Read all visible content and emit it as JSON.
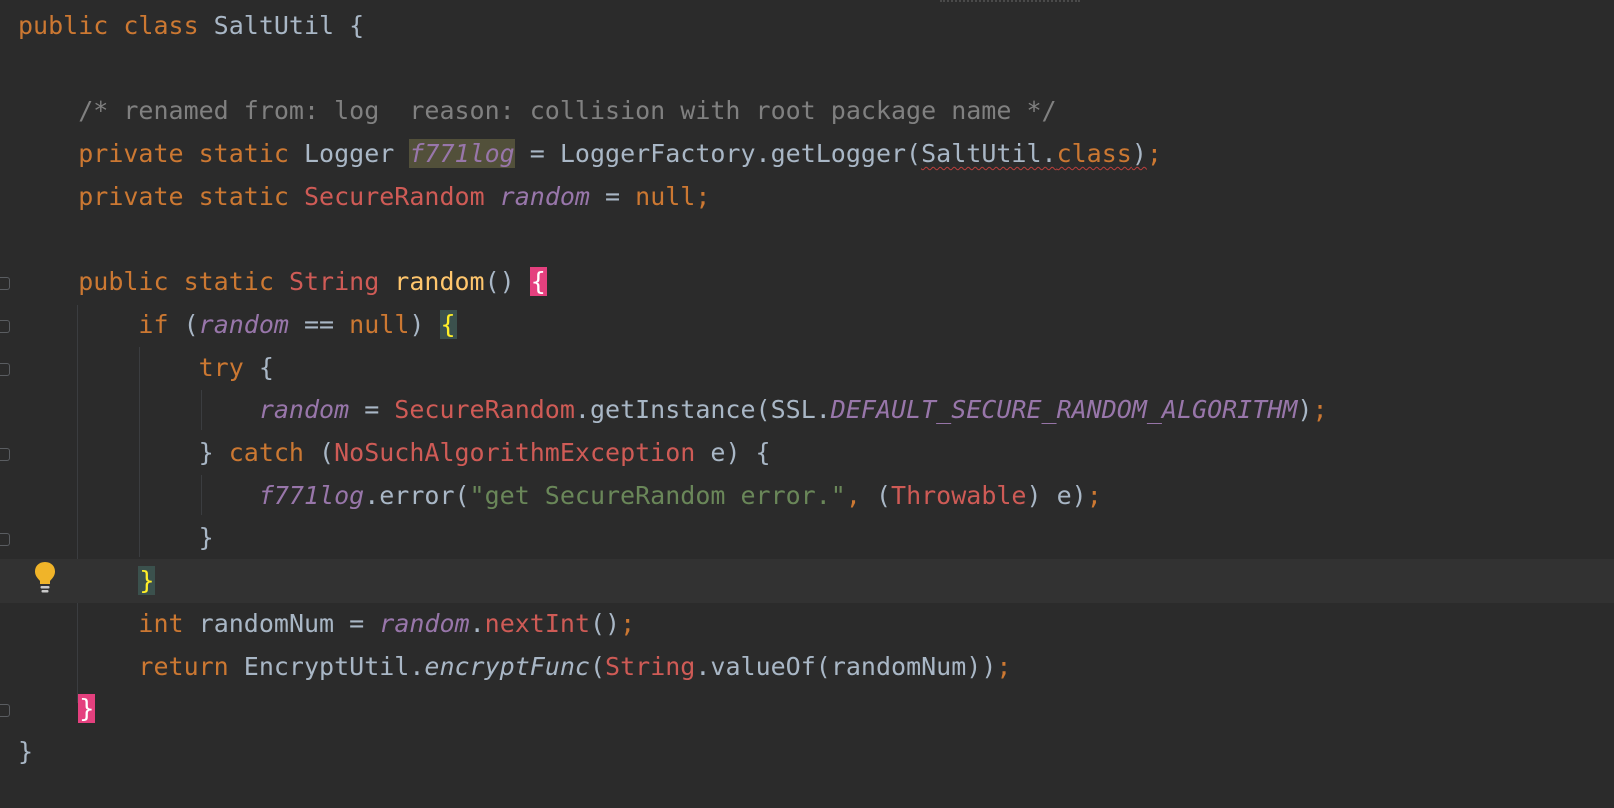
{
  "editor": {
    "language": "Java",
    "highlighted_usage": "f771log",
    "lines": [
      {
        "tokens": [
          [
            "kw",
            "public "
          ],
          [
            "kw",
            "class "
          ],
          [
            "cls",
            "SaltUtil "
          ],
          [
            "pl",
            "{"
          ]
        ]
      },
      {
        "tokens": []
      },
      {
        "tokens": [
          [
            "pl",
            "    "
          ],
          [
            "cmt",
            "/* renamed from: log  reason: collision with root package name */"
          ]
        ]
      },
      {
        "tokens": [
          [
            "pl",
            "    "
          ],
          [
            "kw",
            "private static "
          ],
          [
            "pl",
            "Logger "
          ],
          [
            "field hl-usage",
            "f771log"
          ],
          [
            "pl",
            " = LoggerFactory.getLogger("
          ],
          [
            "pl squiggle",
            "SaltUtil."
          ],
          [
            "kw squiggle",
            "class"
          ],
          [
            "pl squiggle",
            ")"
          ],
          [
            "kw",
            ";"
          ]
        ]
      },
      {
        "tokens": [
          [
            "pl",
            "    "
          ],
          [
            "kw",
            "private static "
          ],
          [
            "type",
            "SecureRandom "
          ],
          [
            "field",
            "random"
          ],
          [
            "pl",
            " = "
          ],
          [
            "kw",
            "null"
          ],
          [
            "kw",
            ";"
          ]
        ]
      },
      {
        "tokens": []
      },
      {
        "tokens": [
          [
            "pl",
            "    "
          ],
          [
            "kw",
            "public static "
          ],
          [
            "type",
            "String "
          ],
          [
            "meth",
            "random"
          ],
          [
            "pl",
            "() "
          ],
          [
            "brace-pink",
            "{"
          ]
        ]
      },
      {
        "tokens": [
          [
            "pl",
            "        "
          ],
          [
            "kw",
            "if "
          ],
          [
            "pl",
            "("
          ],
          [
            "field",
            "random"
          ],
          [
            "pl",
            " == "
          ],
          [
            "kw",
            "null"
          ],
          [
            "pl",
            ") "
          ],
          [
            "brace-match",
            "{"
          ]
        ]
      },
      {
        "tokens": [
          [
            "pl",
            "            "
          ],
          [
            "kw",
            "try "
          ],
          [
            "pl",
            "{"
          ]
        ]
      },
      {
        "tokens": [
          [
            "pl",
            "                "
          ],
          [
            "field",
            "random"
          ],
          [
            "pl",
            " = "
          ],
          [
            "type",
            "SecureRandom"
          ],
          [
            "pl",
            ".getInstance(SSL."
          ],
          [
            "const",
            "DEFAULT_SECURE_RANDOM_ALGORITHM"
          ],
          [
            "pl",
            ")"
          ],
          [
            "kw",
            ";"
          ]
        ]
      },
      {
        "tokens": [
          [
            "pl",
            "            } "
          ],
          [
            "kw",
            "catch "
          ],
          [
            "pl",
            "("
          ],
          [
            "type",
            "NoSuchAlgorithmException "
          ],
          [
            "pl",
            "e) {"
          ]
        ]
      },
      {
        "tokens": [
          [
            "pl",
            "                "
          ],
          [
            "field",
            "f771log"
          ],
          [
            "pl",
            ".error("
          ],
          [
            "str",
            "\"get SecureRandom error.\""
          ],
          [
            "kw",
            ", "
          ],
          [
            "pl",
            "("
          ],
          [
            "type",
            "Throwable"
          ],
          [
            "pl",
            ") e)"
          ],
          [
            "kw",
            ";"
          ]
        ]
      },
      {
        "tokens": [
          [
            "pl",
            "            }"
          ]
        ]
      },
      {
        "tokens": [
          [
            "pl",
            "        "
          ],
          [
            "brace-match",
            "}"
          ]
        ],
        "current": true
      },
      {
        "tokens": [
          [
            "pl",
            "        "
          ],
          [
            "kw",
            "int "
          ],
          [
            "pl",
            "randomNum = "
          ],
          [
            "field",
            "random"
          ],
          [
            "pl",
            "."
          ],
          [
            "type",
            "nextInt"
          ],
          [
            "pl",
            "()"
          ],
          [
            "kw",
            ";"
          ]
        ]
      },
      {
        "tokens": [
          [
            "pl",
            "        "
          ],
          [
            "kw",
            "return "
          ],
          [
            "pl",
            "EncryptUtil."
          ],
          [
            "pl it",
            "encryptFunc"
          ],
          [
            "pl",
            "("
          ],
          [
            "type",
            "String"
          ],
          [
            "pl",
            ".valueOf(randomNum))"
          ],
          [
            "kw",
            ";"
          ]
        ]
      },
      {
        "tokens": [
          [
            "pl",
            "    "
          ],
          [
            "brace-pink",
            "}"
          ]
        ]
      },
      {
        "tokens": [
          [
            "pl",
            "}"
          ]
        ]
      }
    ]
  },
  "icons": {
    "intention": "lightbulb-icon",
    "fold": "fold-marker-icon"
  },
  "colors": {
    "background": "#2b2b2b",
    "keyword": "#cc7832",
    "field": "#9876aa",
    "string": "#6a8759",
    "comment": "#808080",
    "method": "#ffc66d",
    "brace_highlight": "#e4407e",
    "brace_match": "#ffef28"
  }
}
